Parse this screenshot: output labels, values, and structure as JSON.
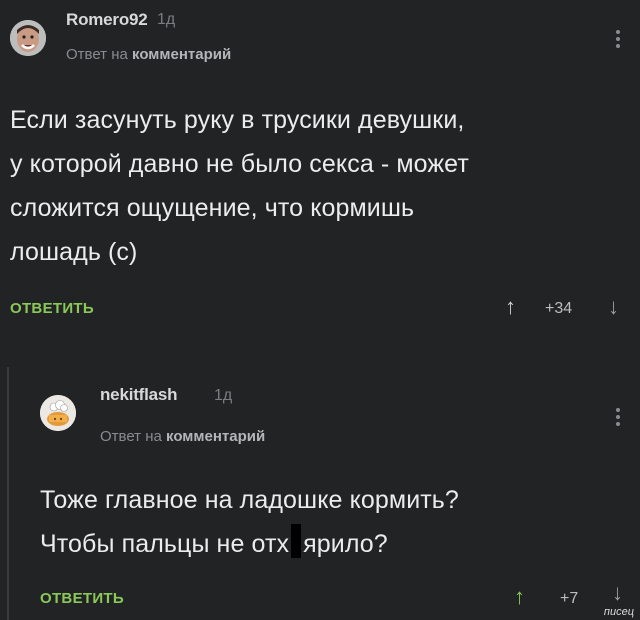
{
  "comments": [
    {
      "username": "Romero92",
      "time": "1д",
      "reply_prefix": "Ответ на",
      "reply_target": "комментарий",
      "lines": [
        "Если засунуть руку в трусики девушки,",
        "у которой давно не было секса - может",
        "сложится ощущение, что кормишь",
        "лошадь (с)"
      ],
      "reply_label": "ОТВЕТИТЬ",
      "votes": "+34",
      "up_icon": "arrow-up-icon",
      "down_icon": "arrow-down-icon"
    },
    {
      "username": "nekitflash",
      "time": "1д",
      "reply_prefix": "Ответ на",
      "reply_target": "комментарий",
      "line1": "Тоже главное на ладошке кормить?",
      "line2a": "Чтобы пальцы не отх",
      "line2b": "ярило?",
      "reply_label": "ОТВЕТИТЬ",
      "votes": "+7"
    }
  ],
  "watermark": "писец",
  "colors": {
    "background": "#222325",
    "accent_green": "#8ac858",
    "text": "#ececec"
  }
}
